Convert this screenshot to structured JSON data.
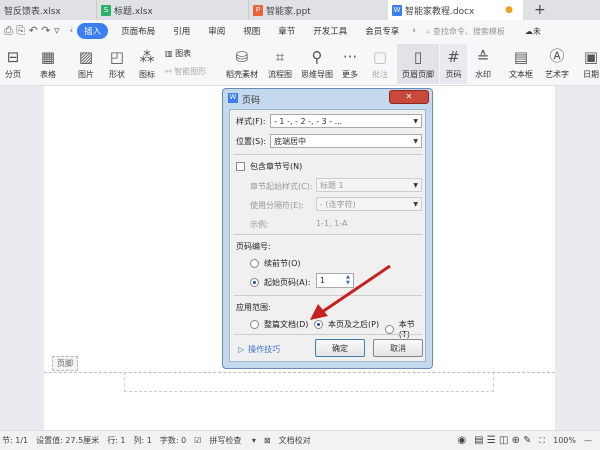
{
  "tabs": [
    {
      "label": "智反馈表.xlsx",
      "icon": "excel"
    },
    {
      "label": "标题.xlsx",
      "icon": "S"
    },
    {
      "label": "智能家.ppt",
      "icon": "P"
    },
    {
      "label": "智能家教程.docx",
      "icon": "W"
    }
  ],
  "new_tab": "+",
  "menu": {
    "items": [
      "插入",
      "页面布局",
      "引用",
      "审阅",
      "视图",
      "章节",
      "开发工具",
      "会员专享"
    ],
    "search_placeholder": "查找命令、搜索模板",
    "cloud": "未"
  },
  "toolbar": [
    "分页",
    "表格",
    "图片",
    "形状",
    "图标",
    "图表",
    "智能图形",
    "稻壳素材",
    "流程图",
    "思维导图",
    "更多",
    "批注",
    "页眉页脚",
    "页码",
    "水印",
    "文本框",
    "艺术字",
    "日期"
  ],
  "footer_label": "页脚",
  "dialog": {
    "title": "页码",
    "style_label": "样式(F):",
    "style_value": "- 1 -, - 2 -, - 3 - ...",
    "position_label": "位置(S):",
    "position_value": "底端居中",
    "include_chapter": "包含章节号(N)",
    "chapter_style_label": "章节起始样式(C):",
    "chapter_style_value": "标题 1",
    "separator_label": "使用分隔符(E):",
    "separator_value": "-    (连字符)",
    "example_label": "示例:",
    "example_value": "1-1, 1-A",
    "numbering_title": "页码编号:",
    "continue": "续前节(O)",
    "start_at": "起始页码(A):",
    "start_value": "1",
    "scope_title": "应用范围:",
    "scope_whole": "整篇文档(D)",
    "scope_after": "本页及之后(P)",
    "scope_section": "本节(T)",
    "tips": "操作技巧",
    "ok": "确定",
    "cancel": "取消",
    "close": "✕"
  },
  "status": {
    "section": "节: 1/1",
    "setting": "设置值: 27.5厘米",
    "row": "行: 1",
    "col": "列: 1",
    "words": "字数: 0",
    "spell": "拼写检查",
    "proof": "文档校对",
    "zoom": "100%"
  }
}
